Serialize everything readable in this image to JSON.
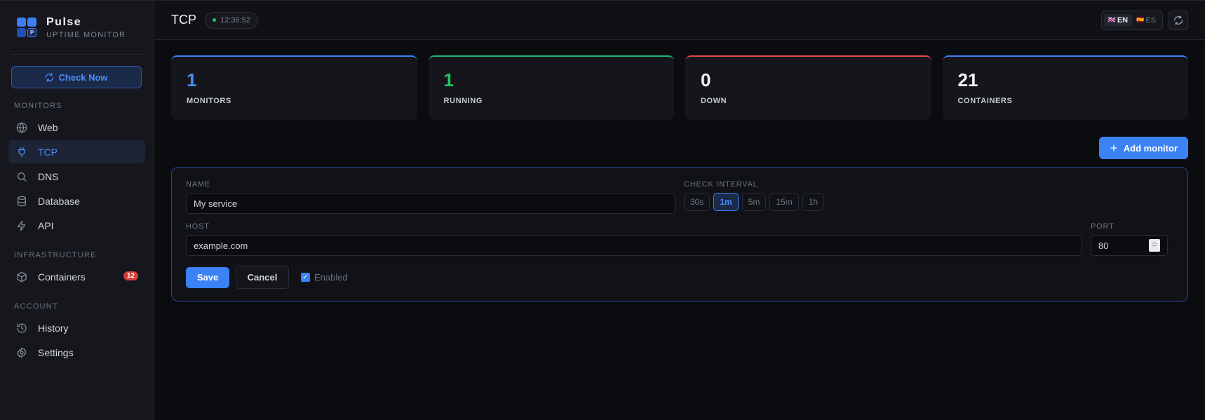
{
  "brand": {
    "name": "Pulse",
    "subtitle": "UPTIME MONITOR",
    "logo_letter": "P"
  },
  "sidebar": {
    "check_now": "Check Now",
    "sections": {
      "monitors": "MONITORS",
      "infrastructure": "INFRASTRUCTURE",
      "account": "ACCOUNT"
    },
    "items": {
      "web": {
        "label": "Web",
        "icon": "globe-icon"
      },
      "tcp": {
        "label": "TCP",
        "icon": "plug-icon",
        "active": true
      },
      "dns": {
        "label": "DNS",
        "icon": "search-icon"
      },
      "database": {
        "label": "Database",
        "icon": "database-icon"
      },
      "api": {
        "label": "API",
        "icon": "lightning-icon"
      },
      "containers": {
        "label": "Containers",
        "icon": "box-icon",
        "badge": "12"
      },
      "history": {
        "label": "History",
        "icon": "history-icon"
      },
      "settings": {
        "label": "Settings",
        "icon": "gear-icon"
      }
    }
  },
  "header": {
    "title": "TCP",
    "time": "12:36:52",
    "languages": [
      {
        "code": "EN",
        "flag": "🇬🇧",
        "active": true
      },
      {
        "code": "ES",
        "flag": "🇪🇸",
        "active": false
      }
    ]
  },
  "stats": [
    {
      "value": "1",
      "label": "MONITORS",
      "accent": "#3d7ef6"
    },
    {
      "value": "1",
      "label": "RUNNING",
      "accent": "#22b573"
    },
    {
      "value": "0",
      "label": "DOWN",
      "accent": "#e04848"
    },
    {
      "value": "21",
      "label": "CONTAINERS",
      "accent": "#3d7ef6"
    }
  ],
  "add_monitor": "Add monitor",
  "form": {
    "name_label": "NAME",
    "name_value": "My service",
    "interval_label": "CHECK INTERVAL",
    "intervals": [
      "30s",
      "1m",
      "5m",
      "15m",
      "1h"
    ],
    "selected_interval": "1m",
    "host_label": "HOST",
    "host_value": "example.com",
    "port_label": "PORT",
    "port_value": "80",
    "save": "Save",
    "cancel": "Cancel",
    "enabled_label": "Enabled",
    "enabled": true
  }
}
